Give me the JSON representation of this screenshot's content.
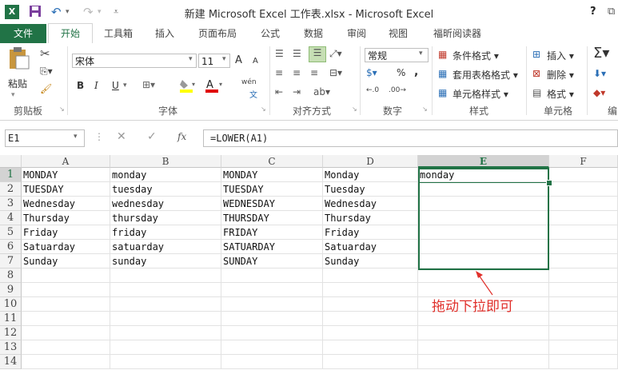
{
  "window": {
    "title": "新建 Microsoft Excel 工作表.xlsx - Microsoft Excel",
    "help": "?"
  },
  "tabs": [
    "文件",
    "开始",
    "工具箱",
    "插入",
    "页面布局",
    "公式",
    "数据",
    "审阅",
    "视图",
    "福昕阅读器"
  ],
  "ribbon": {
    "clipboard": {
      "paste": "粘贴",
      "label": "剪贴板"
    },
    "font": {
      "name": "宋体",
      "size": "11",
      "label": "字体",
      "bold": "B",
      "italic": "I",
      "underline": "U",
      "grow": "A",
      "shrink": "A",
      "phonetic": "wén"
    },
    "alignment": {
      "label": "对齐方式"
    },
    "number": {
      "format": "常规",
      "percent": "%",
      "comma": ",",
      "label": "数字"
    },
    "styles": {
      "cond": "条件格式",
      "table": "套用表格格式",
      "cell": "单元格样式",
      "label": "样式"
    },
    "cells": {
      "insert": "插入",
      "delete": "删除",
      "format": "格式",
      "label": "单元格"
    },
    "editing": {
      "label": "编"
    }
  },
  "formula_bar": {
    "name_box": "E1",
    "fx": "fx",
    "formula": "=LOWER(A1)"
  },
  "sheet": {
    "columns": [
      "A",
      "B",
      "C",
      "D",
      "E",
      "F"
    ],
    "rows": [
      "1",
      "2",
      "3",
      "4",
      "5",
      "6",
      "7",
      "8",
      "9",
      "10",
      "11",
      "12",
      "13",
      "14"
    ],
    "data": [
      [
        "MONDAY",
        "monday",
        "MONDAY",
        "Monday",
        "monday"
      ],
      [
        "TUESDAY",
        "tuesday",
        "TUESDAY",
        "Tuesday",
        ""
      ],
      [
        "Wednesday",
        "wednesday",
        "WEDNESDAY",
        "Wednesday",
        ""
      ],
      [
        "Thursday",
        "thursday",
        "THURSDAY",
        "Thursday",
        ""
      ],
      [
        "Friday",
        "friday",
        "FRIDAY",
        "Friday",
        ""
      ],
      [
        "Satuarday",
        "satuarday",
        "SATUARDAY",
        "Satuarday",
        ""
      ],
      [
        "Sunday",
        "sunday",
        "SUNDAY",
        "Sunday",
        ""
      ]
    ],
    "selected_column": "E",
    "selected_row": "1"
  },
  "annotation": "拖动下拉即可",
  "colors": {
    "excel_green": "#217346",
    "annotation_red": "#e0302b"
  }
}
